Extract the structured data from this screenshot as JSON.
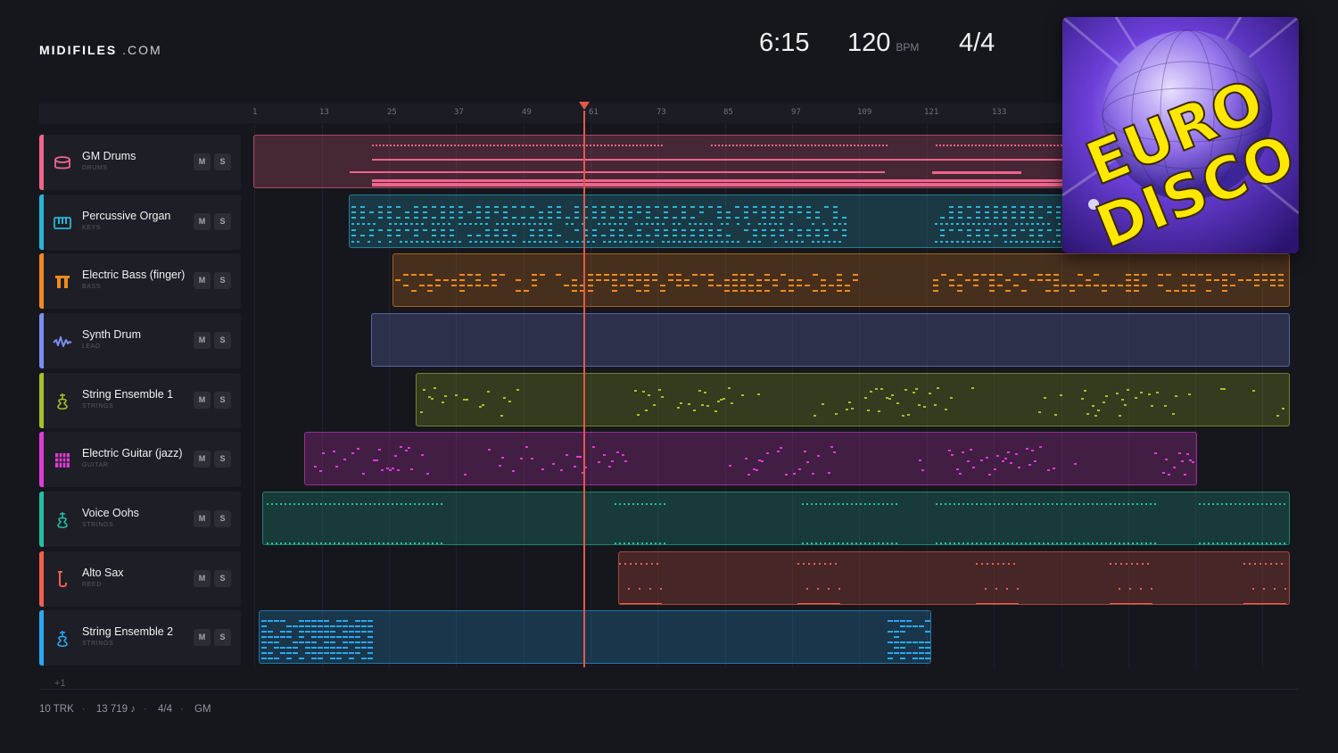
{
  "brand": {
    "name_bold": "MIDIFILES",
    "name_suffix": ".COM"
  },
  "transport": {
    "duration": "6:15",
    "tempo": "120",
    "tempo_unit": "BPM",
    "time_signature": "4/4"
  },
  "ruler": {
    "bars": [
      "1",
      "13",
      "25",
      "37",
      "49",
      "61",
      "73",
      "85",
      "97",
      "109",
      "121",
      "133"
    ]
  },
  "tracks": [
    {
      "name": "GM Drums",
      "category": "DRUMS",
      "color": "#f0648c",
      "icon": "drum-icon",
      "mute": "M",
      "solo": "S"
    },
    {
      "name": "Percussive Organ",
      "category": "KEYS",
      "color": "#29b6d6",
      "icon": "keyboard-icon",
      "mute": "M",
      "solo": "S"
    },
    {
      "name": "Electric Bass (finger)",
      "category": "BASS",
      "color": "#f08a1e",
      "icon": "bass-amp-icon",
      "mute": "M",
      "solo": "S"
    },
    {
      "name": "Synth Drum",
      "category": "LEAD",
      "color": "#7b8df0",
      "icon": "waveform-icon",
      "mute": "M",
      "solo": "S"
    },
    {
      "name": "String Ensemble 1",
      "category": "STRINGS",
      "color": "#a5c02a",
      "icon": "violin-icon",
      "mute": "M",
      "solo": "S"
    },
    {
      "name": "Electric Guitar (jazz)",
      "category": "GUITAR",
      "color": "#e13ad6",
      "icon": "guitar-icon",
      "mute": "M",
      "solo": "S"
    },
    {
      "name": "Voice Oohs",
      "category": "STRINGS",
      "color": "#22c0a0",
      "icon": "violin-icon",
      "mute": "M",
      "solo": "S"
    },
    {
      "name": "Alto Sax",
      "category": "REED",
      "color": "#f0604c",
      "icon": "saxophone-icon",
      "mute": "M",
      "solo": "S"
    },
    {
      "name": "String Ensemble 2",
      "category": "STRINGS",
      "color": "#2aa8f0",
      "icon": "violin-icon",
      "mute": "M",
      "solo": "S"
    }
  ],
  "add_track": "+1",
  "footer": {
    "tracks": "10 TRK",
    "notes": "13 719 ♪",
    "meter": "4/4",
    "standard": "GM"
  },
  "album": {
    "line1": "EURO",
    "line2": "DISCO"
  }
}
